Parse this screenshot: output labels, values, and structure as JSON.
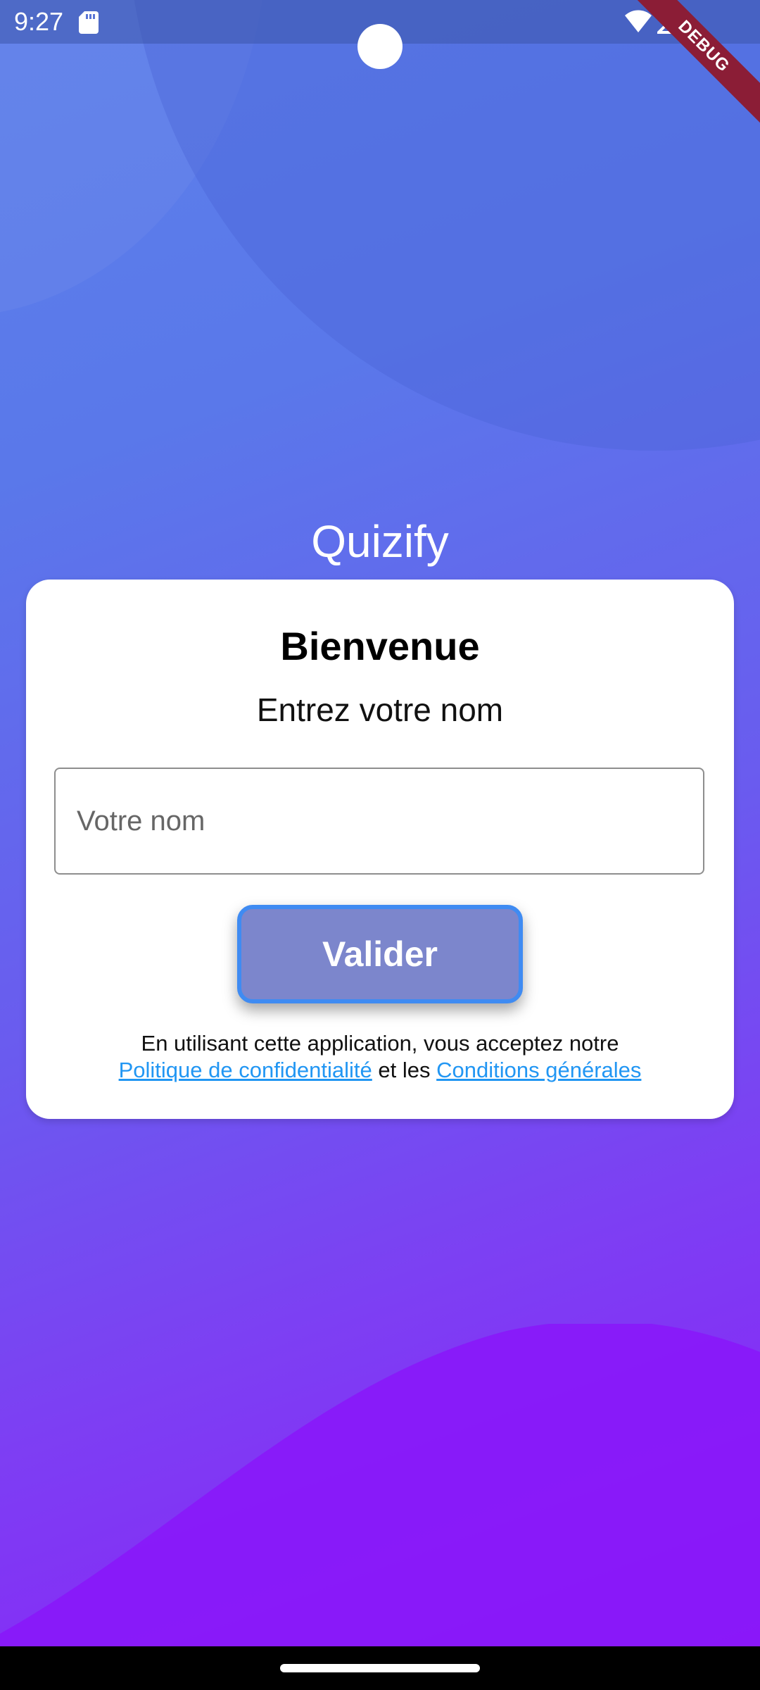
{
  "status_bar": {
    "time": "9:27",
    "icons": [
      "sd-card-icon",
      "wifi-icon",
      "cellular-signal-icon"
    ]
  },
  "debug_banner": "DEBUG",
  "app": {
    "title": "Quizify"
  },
  "card": {
    "title": "Bienvenue",
    "subtitle": "Entrez votre nom",
    "name_input": {
      "placeholder": "Votre nom",
      "value": ""
    },
    "submit_label": "Valider",
    "terms": {
      "prefix": "En utilisant cette application, vous acceptez notre",
      "privacy_link": "Politique de confidentialité",
      "conjunction": "et les",
      "conditions_link": "Conditions générales"
    }
  },
  "colors": {
    "gradient_top": "#5d80ea",
    "gradient_bottom": "#8a1ff8",
    "button_bg": "#7c86cc",
    "button_border": "#3f8bf2",
    "link": "#2196f3",
    "debug_banner": "#8b1d36"
  }
}
